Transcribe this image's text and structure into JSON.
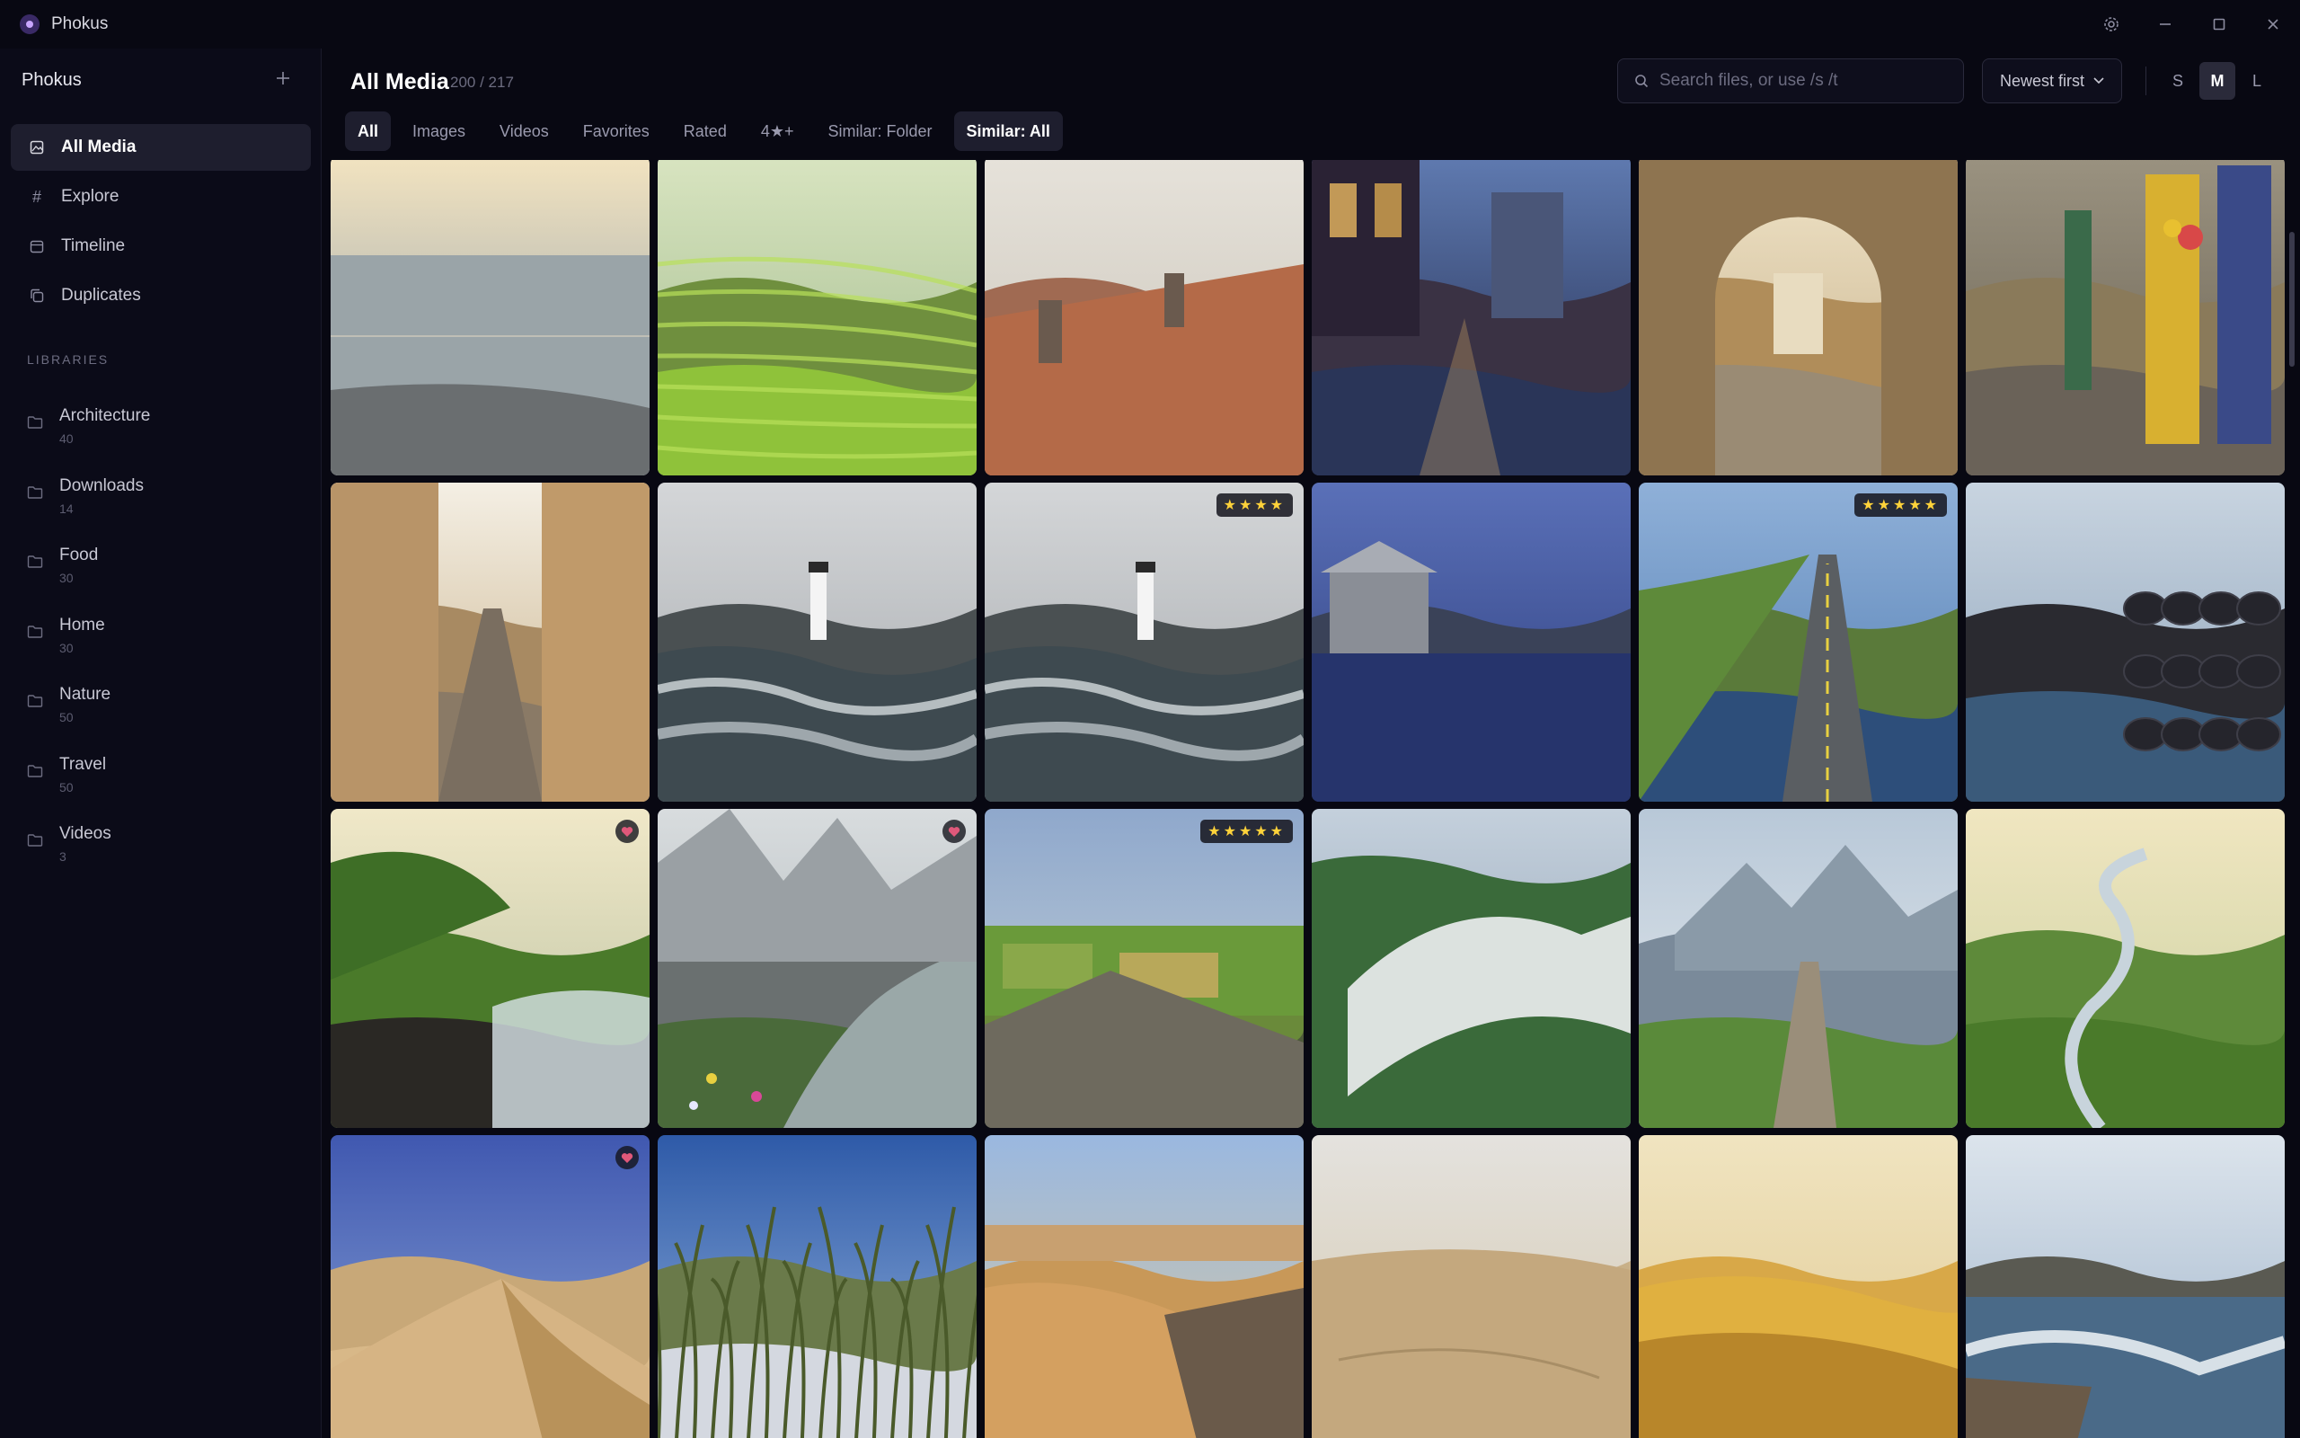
{
  "app": {
    "title": "Phokus"
  },
  "sidebar": {
    "title": "Phokus",
    "nav": [
      {
        "label": "All Media",
        "icon": "image-icon"
      },
      {
        "label": "Explore",
        "icon": "hash-icon"
      },
      {
        "label": "Timeline",
        "icon": "calendar-icon"
      },
      {
        "label": "Duplicates",
        "icon": "copy-icon"
      }
    ],
    "libraries_label": "LIBRARIES",
    "libraries": [
      {
        "name": "Architecture",
        "count": "40"
      },
      {
        "name": "Downloads",
        "count": "14"
      },
      {
        "name": "Food",
        "count": "30"
      },
      {
        "name": "Home",
        "count": "30"
      },
      {
        "name": "Nature",
        "count": "50"
      },
      {
        "name": "Travel",
        "count": "50"
      },
      {
        "name": "Videos",
        "count": "3"
      }
    ]
  },
  "header": {
    "title": "All Media",
    "count": "200 / 217",
    "search_placeholder": "Search files, or use /s /t",
    "sort_label": "Newest first",
    "sizes": [
      "S",
      "M",
      "L"
    ],
    "active_size": "M"
  },
  "tabs": [
    {
      "label": "All",
      "active": true
    },
    {
      "label": "Images",
      "active": false
    },
    {
      "label": "Videos",
      "active": false
    },
    {
      "label": "Favorites",
      "active": false
    },
    {
      "label": "Rated",
      "active": false
    },
    {
      "label": "4★+",
      "active": false
    },
    {
      "label": "Similar: Folder",
      "active": false
    },
    {
      "label": "Similar: All",
      "active": true
    }
  ],
  "grid": {
    "tiles": [
      {
        "subject": "reflecting pool at sunset",
        "rating": 0,
        "favorite": false
      },
      {
        "subject": "green rice terraces",
        "rating": 0,
        "favorite": false
      },
      {
        "subject": "misty terracotta rooftops",
        "rating": 0,
        "favorite": false
      },
      {
        "subject": "rainy city street at night",
        "rating": 0,
        "favorite": false
      },
      {
        "subject": "stone archway to village lane",
        "rating": 0,
        "favorite": false
      },
      {
        "subject": "stone alley with colorful doors",
        "rating": 0,
        "favorite": false
      },
      {
        "subject": "narrow cobblestone street",
        "rating": 0,
        "favorite": false
      },
      {
        "subject": "lighthouse with crashing waves",
        "rating": 0,
        "favorite": false
      },
      {
        "subject": "lighthouse with crashing waves",
        "rating": 4,
        "favorite": false
      },
      {
        "subject": "wooden boathouse on calm water",
        "rating": 0,
        "favorite": false
      },
      {
        "subject": "coastal road along cliffs",
        "rating": 5,
        "favorite": false
      },
      {
        "subject": "basalt rocks by the sea",
        "rating": 0,
        "favorite": false
      },
      {
        "subject": "black sand beach with green cliffs",
        "rating": 0,
        "favorite": true
      },
      {
        "subject": "mountain stream with wildflowers",
        "rating": 0,
        "favorite": true
      },
      {
        "subject": "farmland view from rocky outcrop",
        "rating": 5,
        "favorite": false
      },
      {
        "subject": "fog filling forested valley",
        "rating": 0,
        "favorite": false
      },
      {
        "subject": "alpine trail toward peaks",
        "rating": 0,
        "favorite": false
      },
      {
        "subject": "winding river through green valley",
        "rating": 0,
        "favorite": false
      },
      {
        "subject": "sand dune under blue sky",
        "rating": 0,
        "favorite": true
      },
      {
        "subject": "snowy path between grasses",
        "rating": 0,
        "favorite": false
      },
      {
        "subject": "desert canyon overlook",
        "rating": 0,
        "favorite": false
      },
      {
        "subject": "rippled sand dune",
        "rating": 0,
        "favorite": false
      },
      {
        "subject": "golden desert dunes",
        "rating": 0,
        "favorite": false
      },
      {
        "subject": "waves crashing on rocky shore",
        "rating": 0,
        "favorite": false
      }
    ]
  },
  "colors": {
    "accent": "#c9a6ff",
    "background": "#080812",
    "sidebar": "#0b0b18",
    "star": "#ffd23a",
    "heart": "#e0587a"
  }
}
